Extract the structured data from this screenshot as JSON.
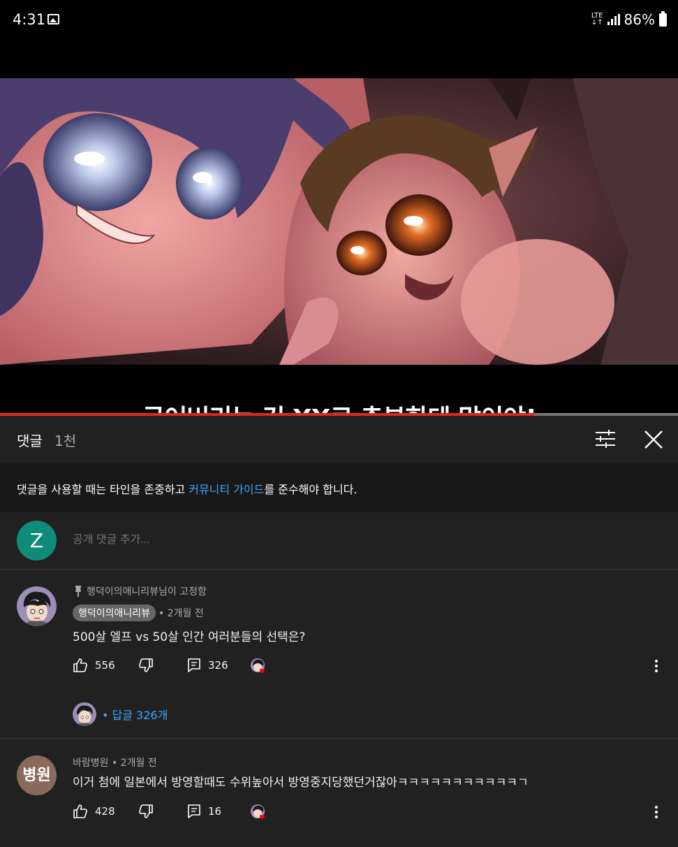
{
  "status_bar": {
    "time": "4:31",
    "network": "LTE",
    "battery": "86%"
  },
  "video": {
    "subtitle": "굳어버리는 건 XX로 충분한데 말이야!",
    "progress": 0.788
  },
  "comments_header": {
    "title": "댓글",
    "count": "1천"
  },
  "guideline": {
    "prefix": "댓글을 사용할 때는 타인을 존중하고 ",
    "link": "커뮤니티 가이드",
    "suffix": "를 준수해야 합니다."
  },
  "add_comment": {
    "avatar_letter": "Z",
    "placeholder": "공개 댓글 추가..."
  },
  "comments": [
    {
      "pinned_text": "행덕이의애니리뷰님이 고정함",
      "author": "행덕이의애니리뷰",
      "time": "• 2개월 전",
      "text": "500살 엘프 vs 50살 인간 여러분들의 선택은?",
      "likes": "556",
      "reply_count": "326",
      "replies_label": "• 답글 326개"
    },
    {
      "avatar_text": "병원",
      "author_meta": "바람병원 • 2개월 전",
      "text": "이거 첨에 일본에서 방영할때도 수위높아서 방영중지당했던거잖아ㅋㅋㅋㅋㅋㅋㅋㅋㅋㅋㅋㄱ",
      "likes": "428",
      "reply_count": "16"
    }
  ],
  "colors": {
    "accent_link": "#3ea6ff",
    "progress": "#e1261c",
    "panel_bg": "#212121",
    "guide_bg": "#181818"
  }
}
